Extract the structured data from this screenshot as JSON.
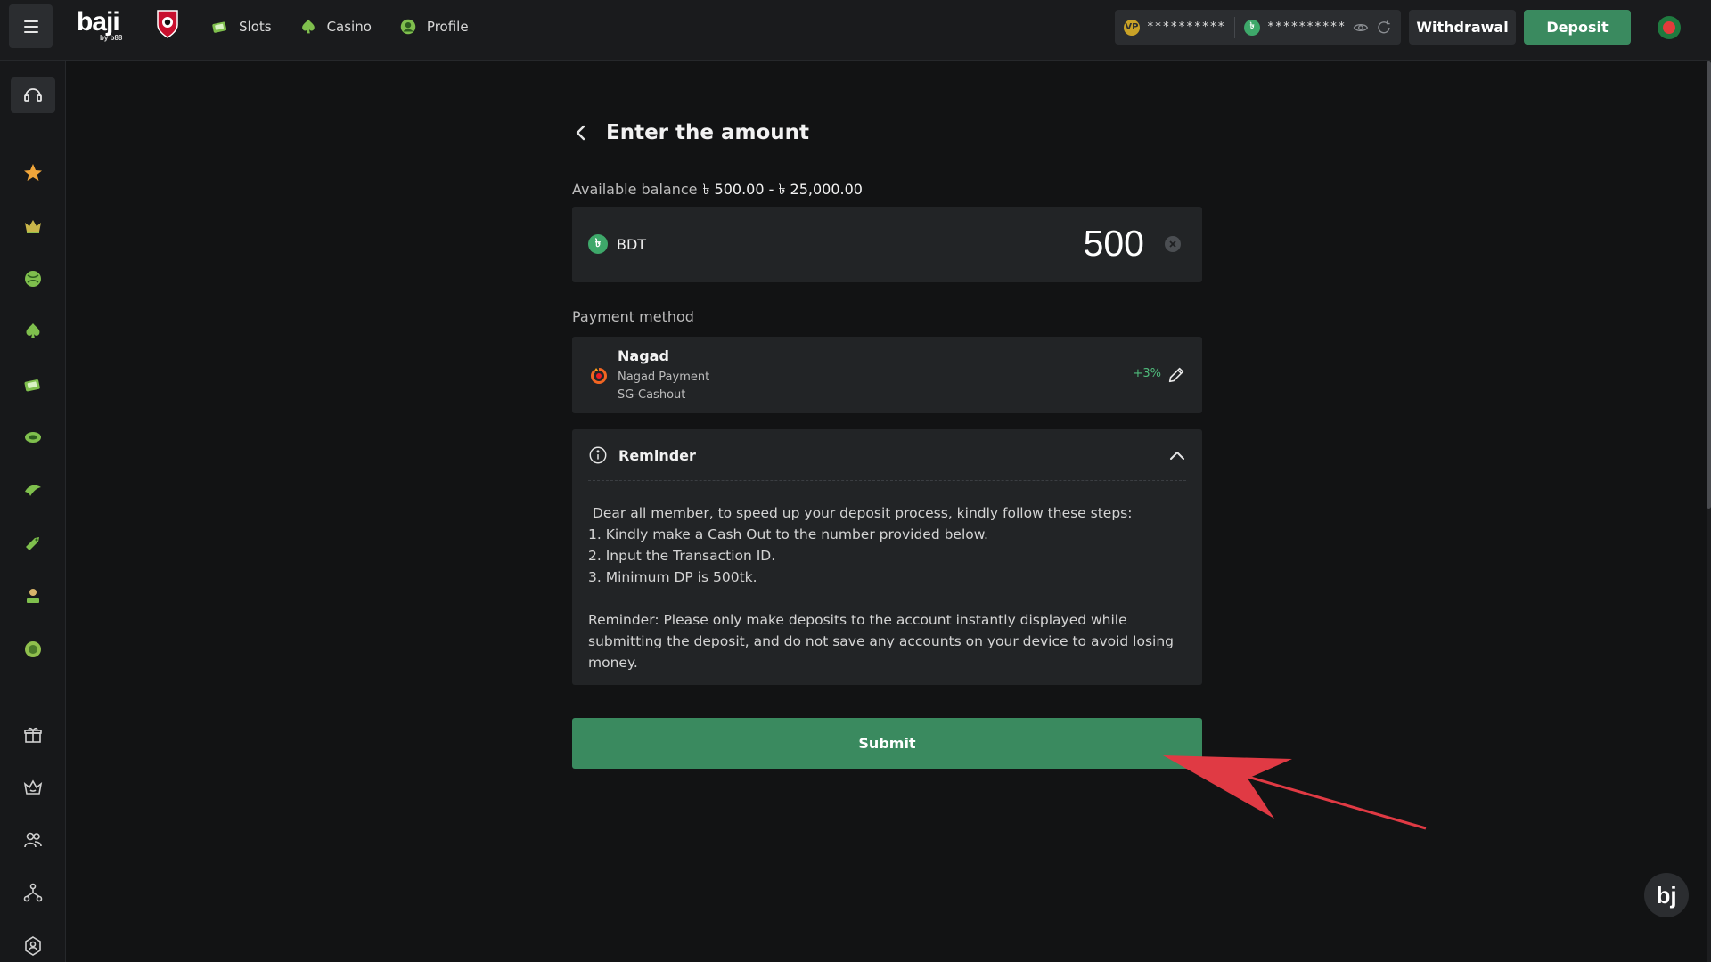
{
  "header": {
    "logo_text": "baji",
    "logo_sub": "by b88",
    "nav": [
      {
        "label": "Slots",
        "icon": "slots-icon"
      },
      {
        "label": "Casino",
        "icon": "casino-icon"
      },
      {
        "label": "Profile",
        "icon": "profile-icon"
      }
    ],
    "wallet": {
      "vip_points": "**********",
      "bdt_balance": "**********"
    },
    "withdrawal_label": "Withdrawal",
    "deposit_label": "Deposit"
  },
  "sidebar": {
    "icons": [
      "support-icon",
      "star-icon",
      "crown-icon",
      "sports-ball-icon",
      "casino-spade-icon",
      "slots-icon",
      "fishing-icon",
      "arcade-icon",
      "lottery-icon",
      "table-games-icon",
      "esports-icon",
      "gift-icon",
      "vip-crown-icon",
      "referral-icon",
      "affiliate-icon",
      "brand-ambassador-icon"
    ]
  },
  "deposit": {
    "title": "Enter the amount",
    "balance_label": "Available balance",
    "balance_range": "৳ 500.00 - ৳ 25,000.00",
    "currency": "BDT",
    "currency_symbol": "৳",
    "amount": "500",
    "payment_method_label": "Payment method",
    "payment": {
      "name": "Nagad",
      "line1": "Nagad Payment",
      "line2": "SG-Cashout",
      "bonus": "+3%"
    },
    "reminder": {
      "title": "Reminder",
      "lines": [
        " Dear all member, to speed up your deposit process, kindly follow these steps:",
        "1. Kindly make a Cash Out to the number provided below.",
        "2. Input the Transaction ID.",
        "3. Minimum DP is 500tk."
      ],
      "note": "Reminder: Please only make deposits to the account instantly displayed while submitting the deposit, and do not save any accounts on your device to avoid losing money."
    },
    "submit_label": "Submit"
  },
  "chat": {
    "label": "bj"
  },
  "colors": {
    "accent": "#3a8a5f",
    "background": "#121314",
    "panel": "#222426",
    "annotation_arrow": "#e03a44"
  }
}
